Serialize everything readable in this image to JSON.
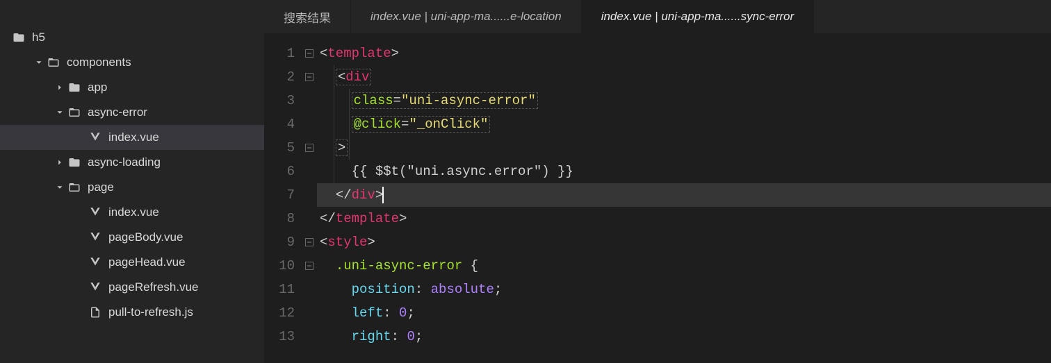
{
  "sidebar": {
    "root": "h5",
    "items": [
      {
        "label": "components",
        "depth": 1,
        "icon": "folder-open",
        "twisty": "down"
      },
      {
        "label": "app",
        "depth": 2,
        "icon": "folder",
        "twisty": "right"
      },
      {
        "label": "async-error",
        "depth": 2,
        "icon": "folder-open",
        "twisty": "down"
      },
      {
        "label": "index.vue",
        "depth": 3,
        "icon": "vue",
        "twisty": "",
        "selected": true
      },
      {
        "label": "async-loading",
        "depth": 2,
        "icon": "folder",
        "twisty": "right"
      },
      {
        "label": "page",
        "depth": 2,
        "icon": "folder-open",
        "twisty": "down"
      },
      {
        "label": "index.vue",
        "depth": 3,
        "icon": "vue",
        "twisty": ""
      },
      {
        "label": "pageBody.vue",
        "depth": 3,
        "icon": "vue",
        "twisty": ""
      },
      {
        "label": "pageHead.vue",
        "depth": 3,
        "icon": "vue",
        "twisty": ""
      },
      {
        "label": "pageRefresh.vue",
        "depth": 3,
        "icon": "vue",
        "twisty": ""
      },
      {
        "label": "pull-to-refresh.js",
        "depth": 3,
        "icon": "js",
        "twisty": ""
      }
    ]
  },
  "tabs": [
    {
      "label": "搜索结果",
      "italic": false,
      "active": false
    },
    {
      "label": "index.vue | uni-app-ma......e-location",
      "italic": true,
      "active": false
    },
    {
      "label": "index.vue | uni-app-ma......sync-error",
      "italic": true,
      "active": true
    }
  ],
  "code": {
    "line1": {
      "open": "<",
      "tag": "template",
      "close": ">"
    },
    "line2": {
      "open": "<",
      "tag": "div"
    },
    "line3": {
      "attr": "class",
      "eq": "=",
      "val": "\"uni-async-error\""
    },
    "line4": {
      "attr": "@click",
      "eq": "=",
      "val": "\"_onClick\""
    },
    "line5": {
      "close": ">"
    },
    "line6": {
      "text": "{{ $$t(\"uni.async.error\") }}"
    },
    "line7": {
      "open": "</",
      "tag": "div",
      "close": ">"
    },
    "line8": {
      "open": "</",
      "tag": "template",
      "close": ">"
    },
    "line9": {
      "open": "<",
      "tag": "style",
      "close": ">"
    },
    "line10": {
      "sel": ".uni-async-error",
      "brace": " {"
    },
    "line11": {
      "prop": "position",
      "colon": ": ",
      "val": "absolute",
      "semi": ";"
    },
    "line12": {
      "prop": "left",
      "colon": ": ",
      "val": "0",
      "semi": ";"
    },
    "line13": {
      "prop": "right",
      "colon": ": ",
      "val": "0",
      "semi": ";"
    }
  },
  "lineNumbers": [
    "1",
    "2",
    "3",
    "4",
    "5",
    "6",
    "7",
    "8",
    "9",
    "10",
    "11",
    "12",
    "13"
  ],
  "fold": [
    "box",
    "box",
    "",
    "",
    "box",
    "",
    "",
    "",
    "box",
    "box",
    "",
    "",
    ""
  ]
}
